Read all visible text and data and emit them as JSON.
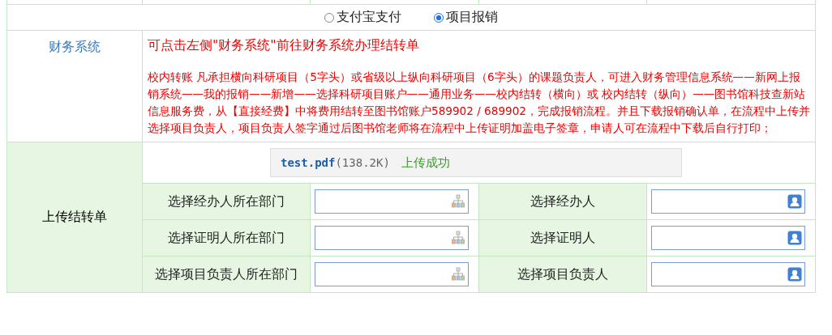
{
  "payment_options": [
    {
      "label": "支付宝支付",
      "selected": false
    },
    {
      "label": "项目报销",
      "selected": true
    }
  ],
  "finance": {
    "label": "财务系统",
    "heading": "可点击左侧\"财务系统\"前往财务系统办理结转单",
    "note": "校内转账 凡承担横向科研项目（5字头）或省级以上纵向科研项目（6字头）的课题负责人，可进入财务管理信息系统——新网上报销系统——我的报销——新增——选择科研项目账户——通用业务——校内结转（横向）或 校内结转（纵向）——图书馆科技查新站信息服务费，从【直接经费】中将费用结转至图书馆账户589902 / 689902，完成报销流程。并且下载报销确认单，在流程中上传并选择项目负责人，项目负责人签字通过后图书馆老师将在流程中上传证明加盖电子签章，申请人可在流程中下载后自行打印；"
  },
  "upload": {
    "label": "上传结转单",
    "file_name": "test.pdf",
    "file_size": "(138.2K)",
    "status": "上传成功",
    "rows": [
      [
        {
          "label": "选择经办人所在部门",
          "kind": "department"
        },
        {
          "label": "选择经办人",
          "kind": "person"
        }
      ],
      [
        {
          "label": "选择证明人所在部门",
          "kind": "department"
        },
        {
          "label": "选择证明人",
          "kind": "person"
        }
      ],
      [
        {
          "label": "选择项目负责人所在部门",
          "kind": "department"
        },
        {
          "label": "选择项目负责人",
          "kind": "person"
        }
      ]
    ]
  }
}
